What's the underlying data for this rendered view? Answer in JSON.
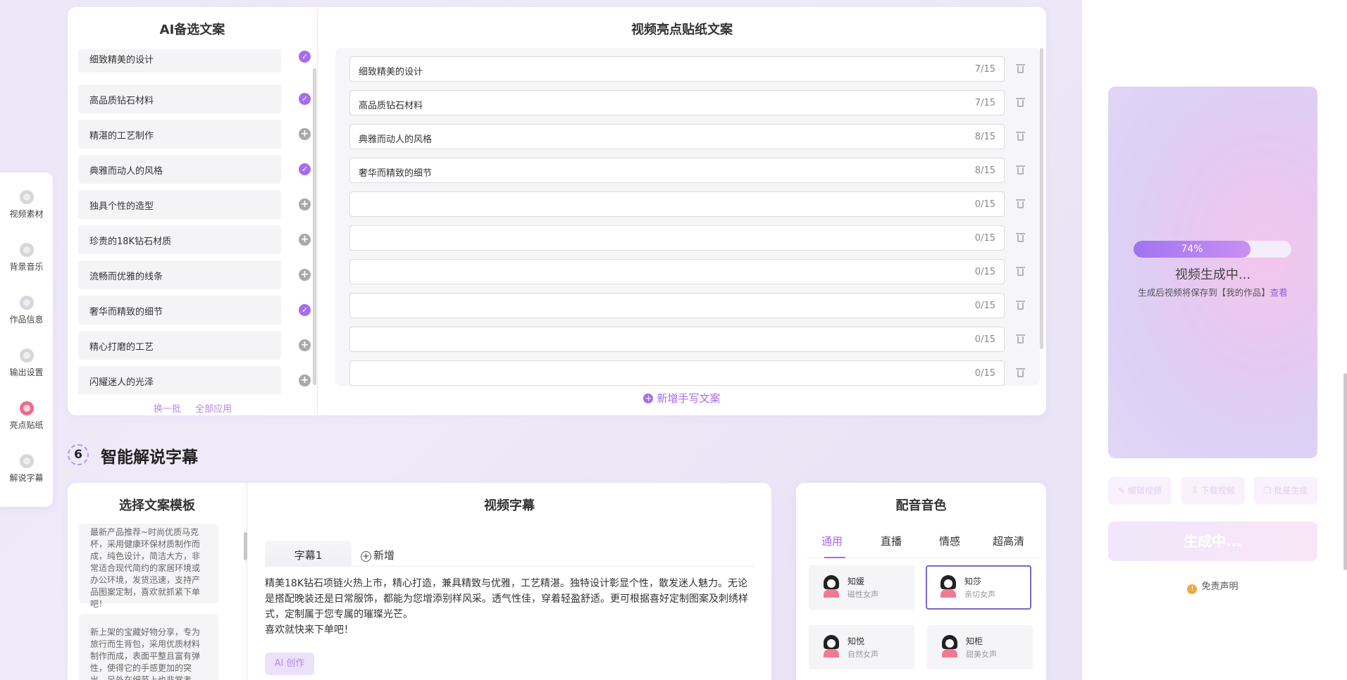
{
  "nav": {
    "items": [
      {
        "label": "视频素材",
        "icon": "video-material-icon"
      },
      {
        "label": "背景音乐",
        "icon": "music-icon"
      },
      {
        "label": "作品信息",
        "icon": "info-icon"
      },
      {
        "label": "输出设置",
        "icon": "output-settings-icon"
      },
      {
        "label": "亮点贴纸",
        "icon": "sticker-icon",
        "active": true
      },
      {
        "label": "解说字幕",
        "icon": "subtitle-icon"
      }
    ]
  },
  "ai_panel": {
    "title": "AI备选文案",
    "items": [
      {
        "label": "细致精美的设计",
        "selected": true
      },
      {
        "label": "高品质钻石材料",
        "selected": true
      },
      {
        "label": "精湛的工艺制作",
        "selected": false
      },
      {
        "label": "典雅而动人的风格",
        "selected": true
      },
      {
        "label": "独具个性的造型",
        "selected": false
      },
      {
        "label": "珍贵的18K钻石材质",
        "selected": false
      },
      {
        "label": "流畅而优雅的线条",
        "selected": false
      },
      {
        "label": "奢华而精致的细节",
        "selected": true
      },
      {
        "label": "精心打磨的工艺",
        "selected": false
      },
      {
        "label": "闪耀迷人的光泽",
        "selected": false
      }
    ],
    "refresh_label": "换一批",
    "apply_all_label": "全部应用"
  },
  "sticker_panel": {
    "title": "视频亮点贴纸文案",
    "rows": [
      {
        "text": "细致精美的设计",
        "count": "7/15"
      },
      {
        "text": "高品质钻石材料",
        "count": "7/15"
      },
      {
        "text": "典雅而动人的风格",
        "count": "8/15"
      },
      {
        "text": "奢华而精致的细节",
        "count": "8/15"
      },
      {
        "text": "",
        "count": "0/15"
      },
      {
        "text": "",
        "count": "0/15"
      },
      {
        "text": "",
        "count": "0/15"
      },
      {
        "text": "",
        "count": "0/15"
      },
      {
        "text": "",
        "count": "0/15"
      },
      {
        "text": "",
        "count": "0/15"
      }
    ],
    "add_manual_label": "新增手写文案"
  },
  "section6": {
    "number": "6",
    "title": "智能解说字幕"
  },
  "template_panel": {
    "title": "选择文案模板",
    "cards": [
      "最新产品推荐~时尚优质马克杯，采用健康环保材质制作而成，纯色设计，简洁大方，非常适合现代简约的家居环境或办公环境，发货迅速，支持产品图案定制，喜欢就抓紧下单吧！",
      "新上架的宝藏好物分享，专为旅行而生背包，采用优质材料制作而成，表面平整且富有弹性，使得它的手感更加的突出，另外在细节上也非常考究，做工精美，喜欢就快"
    ]
  },
  "subtitle_panel": {
    "title": "视频字幕",
    "tab_label": "字幕1",
    "add_tab_label": "新增",
    "text_lines": [
      "精美18K钻石项链火热上市，精心打造，兼具精致与优雅，工艺精湛。独特设计彰显个性，散发迷人魅力。无论",
      "是搭配晚装还是日常服饰，都能为您增添别样风采。透气性佳，穿着轻盈舒适。更可根据喜好定制图案及刺绣样",
      "式，定制属于您专属的璀璨光芒。",
      "喜欢就快来下单吧！"
    ],
    "ai_create_label": "AI 创作"
  },
  "voice_panel": {
    "title": "配音音色",
    "tabs": [
      "通用",
      "直播",
      "情感",
      "超高清"
    ],
    "active_tab": "通用",
    "voices": [
      {
        "name": "知媛",
        "desc": "磁性女声",
        "selected": false
      },
      {
        "name": "知莎",
        "desc": "亲切女声",
        "selected": true
      },
      {
        "name": "知悦",
        "desc": "自然女声",
        "selected": false
      },
      {
        "name": "知柜",
        "desc": "甜美女声",
        "selected": false
      }
    ]
  },
  "preview": {
    "progress": 74,
    "progress_label": "74%",
    "status_title": "视频生成中...",
    "status_sub": "生成后视频将保存到【我的作品】",
    "view_link": "查看",
    "edit_label": "编辑视频",
    "download_label": "下载视频",
    "batch_label": "批量生成",
    "generate_label": "生成中...",
    "disclaimer_label": "免责声明"
  },
  "colors": {
    "accent": "#a66cf0",
    "progress_start": "#a074f0",
    "progress_end": "#c98ff3",
    "warning": "#f2a93b"
  }
}
